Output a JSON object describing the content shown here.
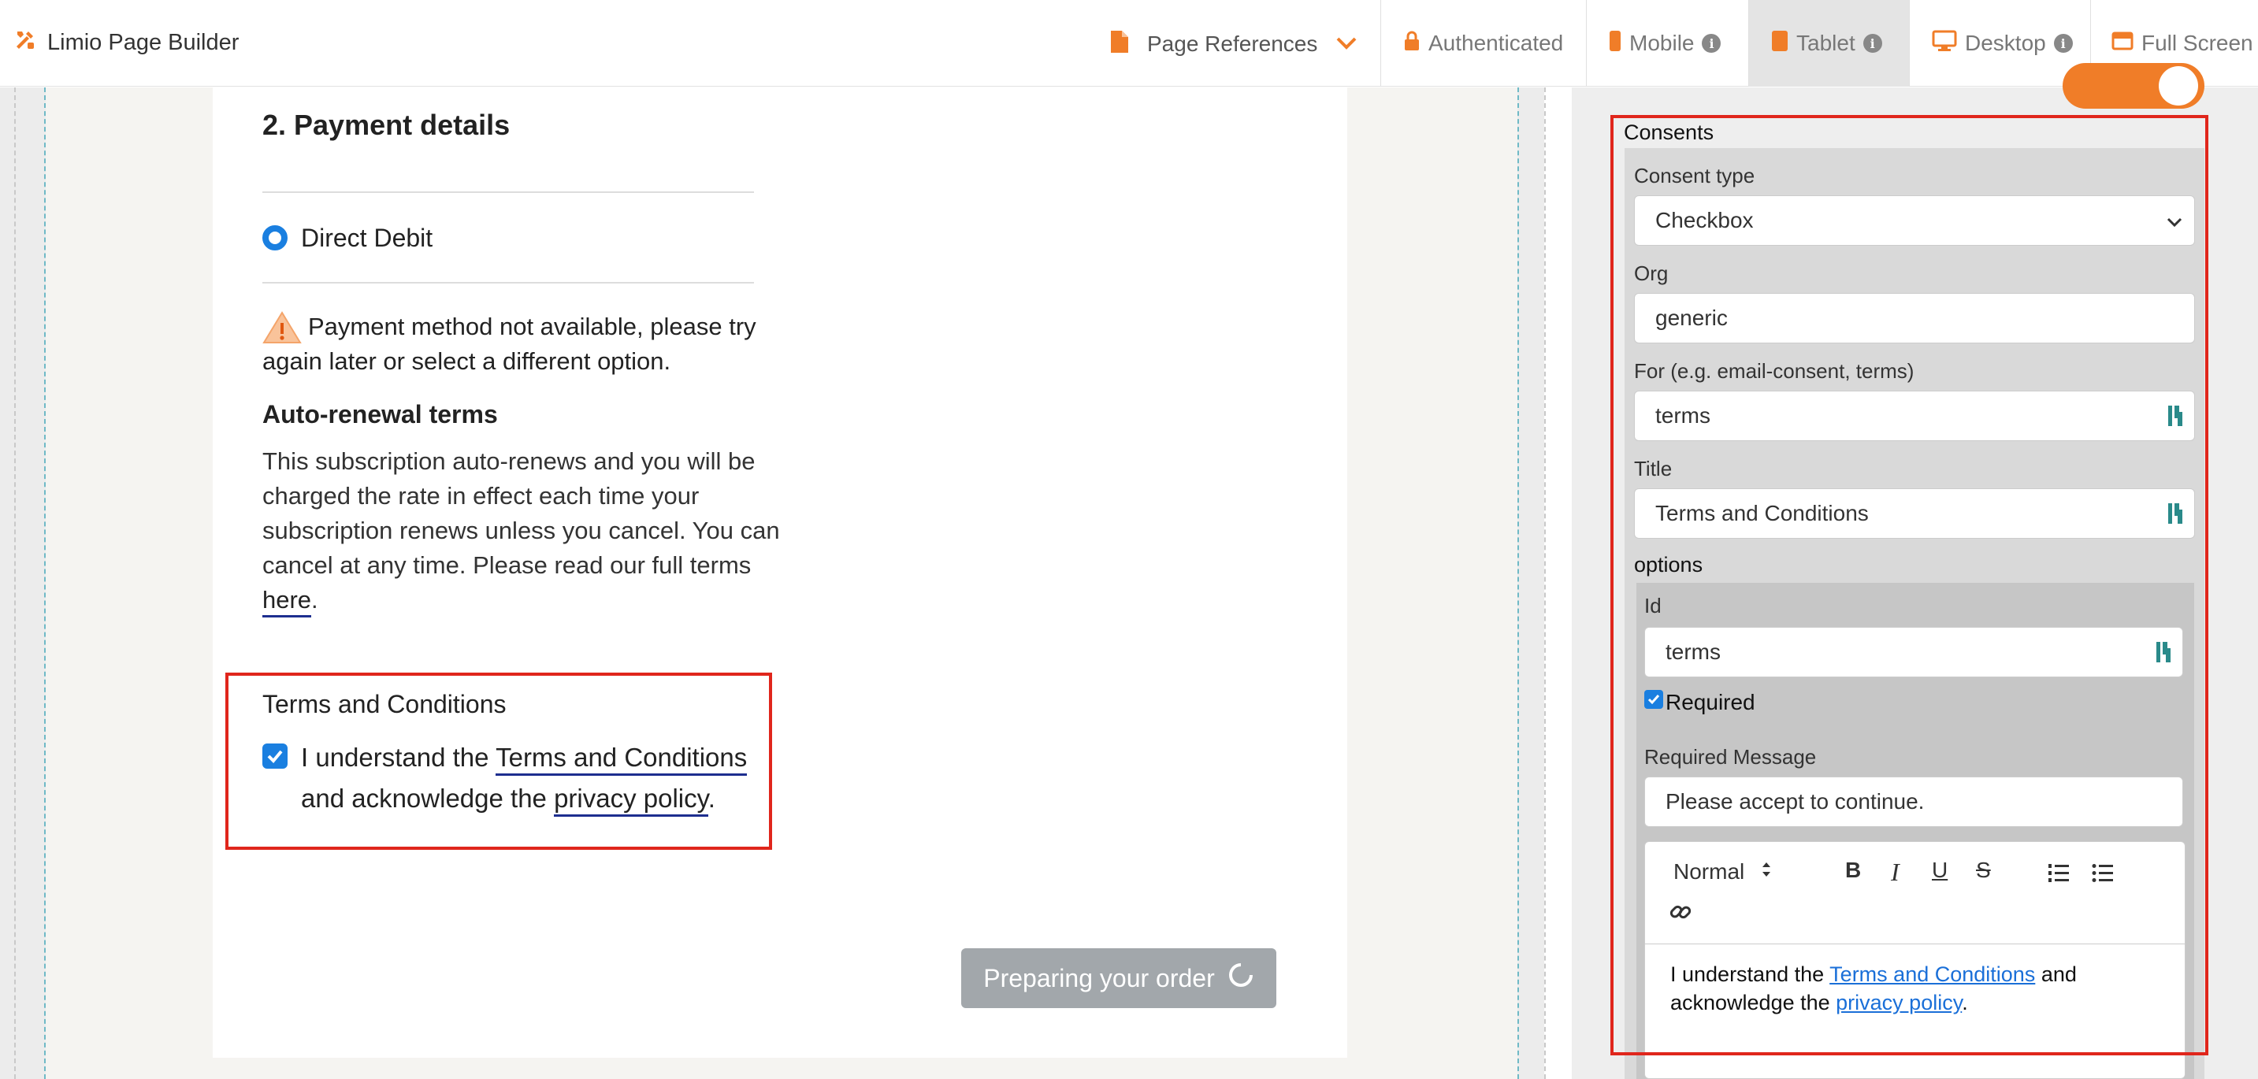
{
  "app": {
    "title": "Limio Page Builder"
  },
  "topbar": {
    "page_references": "Page References",
    "authenticated": "Authenticated",
    "mobile": "Mobile",
    "tablet": "Tablet",
    "desktop": "Desktop",
    "full_screen": "Full Screen",
    "active_view": "Tablet"
  },
  "preview": {
    "section_title": "2. Payment details",
    "payment_option": "Direct Debit",
    "warning_text": "Payment method not available, please try again later or select a different option.",
    "autorenew_title": "Auto-renewal terms",
    "autorenew_text": "This subscription auto-renews and you will be charged the rate in effect each time your subscription renews unless you cancel. You can cancel at any time. Please read our full terms ",
    "autorenew_link": "here",
    "autorenew_end": ".",
    "tc_title": "Terms and Conditions",
    "tc_prefix": "I understand the ",
    "tc_link": "Terms and Conditions",
    "tc_mid": " and acknowledge the ",
    "tc_link2": "privacy policy",
    "tc_end": ".",
    "tc_checked": true,
    "submit_label": "Preparing your order"
  },
  "panel": {
    "section_label": "Consents",
    "consent_type_label": "Consent type",
    "consent_type_value": "Checkbox",
    "org_label": "Org",
    "org_value": "generic",
    "for_label": "For (e.g. email-consent, terms)",
    "for_value": "terms",
    "title_label": "Title",
    "title_value": "Terms and Conditions",
    "options_label": "options",
    "id_label": "Id",
    "id_value": "terms",
    "required_label": "Required",
    "required_checked": true,
    "required_message_label": "Required Message",
    "required_message_value": "Please accept to continue.",
    "editor": {
      "format_value": "Normal",
      "body_prefix": "I understand the ",
      "body_link": "Terms and Conditions",
      "body_mid": " and acknowledge the ",
      "body_link2": "privacy policy",
      "body_end": "."
    }
  },
  "colors": {
    "accent": "#f07d28",
    "primary": "#1a7fe0",
    "highlight": "#e0261c",
    "link": "#1d2e8f"
  }
}
